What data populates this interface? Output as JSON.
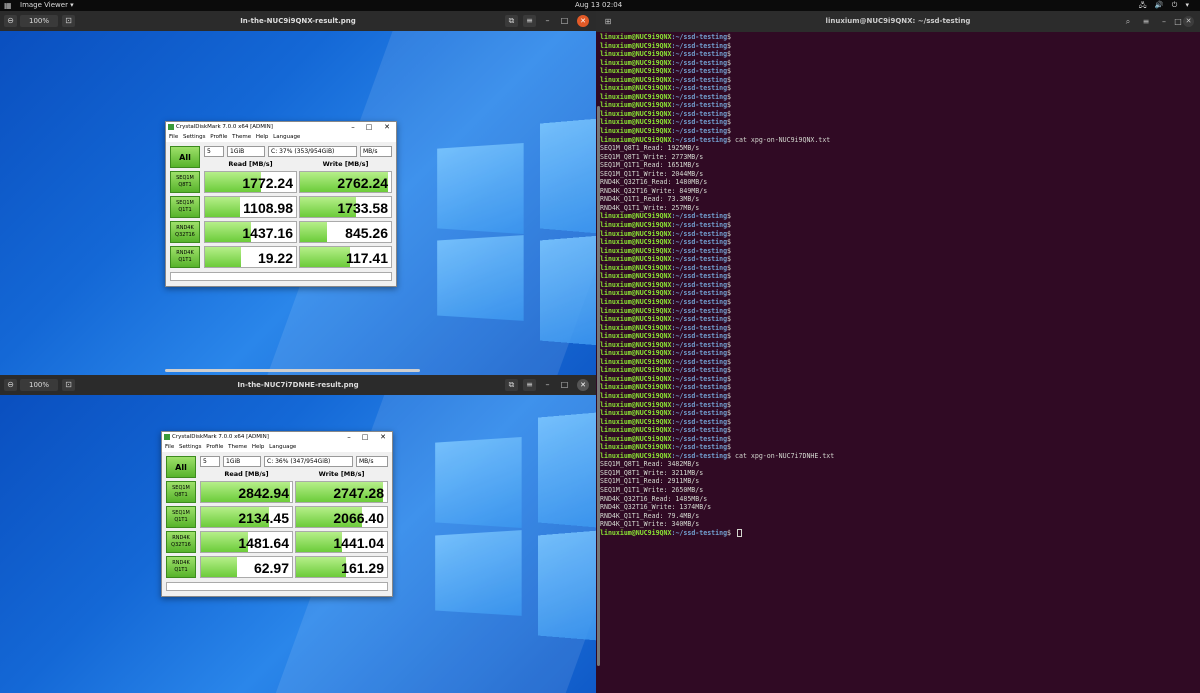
{
  "topbar": {
    "activities": "▦",
    "app_name": "Image Viewer ▾",
    "clock": "Aug 13  02:04",
    "tray": "🖧 🔊 ⏻ ▾"
  },
  "viewers": [
    {
      "zoom": "100%",
      "title": "In-the-NUC9i9QNX-result.png",
      "cdm": {
        "title": "CrystalDiskMark 7.0.0 x64 [ADMIN]",
        "menu": [
          "File",
          "Settings",
          "Profile",
          "Theme",
          "Help",
          "Language"
        ],
        "all_label": "All",
        "count": "5",
        "size": "1GiB",
        "drive": "C: 37% (353/954GiB)",
        "unit": "MB/s",
        "read_header": "Read [MB/s]",
        "write_header": "Write [MB/s]",
        "rows": [
          {
            "l1": "SEQ1M",
            "l2": "Q8T1",
            "read": "1772.24",
            "write": "2762.24",
            "read_fill": 0.62,
            "write_fill": 0.97
          },
          {
            "l1": "SEQ1M",
            "l2": "Q1T1",
            "read": "1108.98",
            "write": "1733.58",
            "read_fill": 0.39,
            "write_fill": 0.61
          },
          {
            "l1": "RND4K",
            "l2": "Q32T16",
            "read": "1437.16",
            "write": "845.26",
            "read_fill": 0.5,
            "write_fill": 0.3
          },
          {
            "l1": "RND4K",
            "l2": "Q1T1",
            "read": "19.22",
            "write": "117.41",
            "read_fill": 0.4,
            "write_fill": 0.55
          }
        ]
      }
    },
    {
      "zoom": "100%",
      "title": "In-the-NUC7i7DNHE-result.png",
      "cdm": {
        "title": "CrystalDiskMark 7.0.0 x64 [ADMIN]",
        "menu": [
          "File",
          "Settings",
          "Profile",
          "Theme",
          "Help",
          "Language"
        ],
        "all_label": "All",
        "count": "5",
        "size": "1GiB",
        "drive": "C: 36% (347/954GiB)",
        "unit": "MB/s",
        "read_header": "Read [MB/s]",
        "write_header": "Write [MB/s]",
        "rows": [
          {
            "l1": "SEQ1M",
            "l2": "Q8T1",
            "read": "2842.94",
            "write": "2747.28",
            "read_fill": 0.98,
            "write_fill": 0.96
          },
          {
            "l1": "SEQ1M",
            "l2": "Q1T1",
            "read": "2134.45",
            "write": "2066.40",
            "read_fill": 0.75,
            "write_fill": 0.73
          },
          {
            "l1": "RND4K",
            "l2": "Q32T16",
            "read": "1481.64",
            "write": "1441.04",
            "read_fill": 0.52,
            "write_fill": 0.5
          },
          {
            "l1": "RND4K",
            "l2": "Q1T1",
            "read": "62.97",
            "write": "161.29",
            "read_fill": 0.4,
            "write_fill": 0.55
          }
        ]
      }
    }
  ],
  "terminal": {
    "title": "linuxium@NUC9i9QNX: ~/ssd-testing",
    "user": "linuxium@NUC9i9QNX",
    "path": ":~/ssd-testing",
    "lines": [
      {
        "type": "prompt",
        "cmd": ""
      },
      {
        "type": "prompt",
        "cmd": ""
      },
      {
        "type": "prompt",
        "cmd": ""
      },
      {
        "type": "prompt",
        "cmd": ""
      },
      {
        "type": "prompt",
        "cmd": ""
      },
      {
        "type": "prompt",
        "cmd": ""
      },
      {
        "type": "prompt",
        "cmd": ""
      },
      {
        "type": "prompt",
        "cmd": ""
      },
      {
        "type": "prompt",
        "cmd": ""
      },
      {
        "type": "prompt",
        "cmd": ""
      },
      {
        "type": "prompt",
        "cmd": ""
      },
      {
        "type": "prompt",
        "cmd": ""
      },
      {
        "type": "prompt",
        "cmd": " cat xpg-on-NUC9i9QNX.txt"
      },
      {
        "type": "out",
        "text": "SEQ1M_Q8T1_Read: 1925MB/s"
      },
      {
        "type": "out",
        "text": "SEQ1M_Q8T1_Write: 2773MB/s"
      },
      {
        "type": "out",
        "text": "SEQ1M_Q1T1_Read: 1651MB/s"
      },
      {
        "type": "out",
        "text": "SEQ1M_Q1T1_Write: 2044MB/s"
      },
      {
        "type": "out",
        "text": "RND4K_Q32T16_Read: 1480MB/s"
      },
      {
        "type": "out",
        "text": "RND4K_Q32T16_Write: 849MB/s"
      },
      {
        "type": "out",
        "text": "RND4K_Q1T1_Read: 73.3MB/s"
      },
      {
        "type": "out",
        "text": "RND4K_Q1T1_Write: 257MB/s"
      },
      {
        "type": "prompt",
        "cmd": ""
      },
      {
        "type": "prompt",
        "cmd": ""
      },
      {
        "type": "prompt",
        "cmd": ""
      },
      {
        "type": "prompt",
        "cmd": ""
      },
      {
        "type": "prompt",
        "cmd": ""
      },
      {
        "type": "prompt",
        "cmd": ""
      },
      {
        "type": "prompt",
        "cmd": ""
      },
      {
        "type": "prompt",
        "cmd": ""
      },
      {
        "type": "prompt",
        "cmd": ""
      },
      {
        "type": "prompt",
        "cmd": ""
      },
      {
        "type": "prompt",
        "cmd": ""
      },
      {
        "type": "prompt",
        "cmd": ""
      },
      {
        "type": "prompt",
        "cmd": ""
      },
      {
        "type": "prompt",
        "cmd": ""
      },
      {
        "type": "prompt",
        "cmd": ""
      },
      {
        "type": "prompt",
        "cmd": ""
      },
      {
        "type": "prompt",
        "cmd": ""
      },
      {
        "type": "prompt",
        "cmd": ""
      },
      {
        "type": "prompt",
        "cmd": ""
      },
      {
        "type": "prompt",
        "cmd": ""
      },
      {
        "type": "prompt",
        "cmd": ""
      },
      {
        "type": "prompt",
        "cmd": ""
      },
      {
        "type": "prompt",
        "cmd": ""
      },
      {
        "type": "prompt",
        "cmd": ""
      },
      {
        "type": "prompt",
        "cmd": ""
      },
      {
        "type": "prompt",
        "cmd": ""
      },
      {
        "type": "prompt",
        "cmd": ""
      },
      {
        "type": "prompt",
        "cmd": ""
      },
      {
        "type": "prompt",
        "cmd": " cat xpg-on-NUC7i7DNHE.txt"
      },
      {
        "type": "out",
        "text": "SEQ1M_Q8T1_Read: 3482MB/s"
      },
      {
        "type": "out",
        "text": "SEQ1M_Q8T1_Write: 3211MB/s"
      },
      {
        "type": "out",
        "text": "SEQ1M_Q1T1_Read: 2911MB/s"
      },
      {
        "type": "out",
        "text": "SEQ1M_Q1T1_Write: 2650MB/s"
      },
      {
        "type": "out",
        "text": "RND4K_Q32T16_Read: 1485MB/s"
      },
      {
        "type": "out",
        "text": "RND4K_Q32T16_Write: 1374MB/s"
      },
      {
        "type": "out",
        "text": "RND4K_Q1T1_Read: 79.4MB/s"
      },
      {
        "type": "out",
        "text": "RND4K_Q1T1_Write: 340MB/s"
      },
      {
        "type": "prompt",
        "cmd": " ",
        "cursor": true
      }
    ]
  }
}
